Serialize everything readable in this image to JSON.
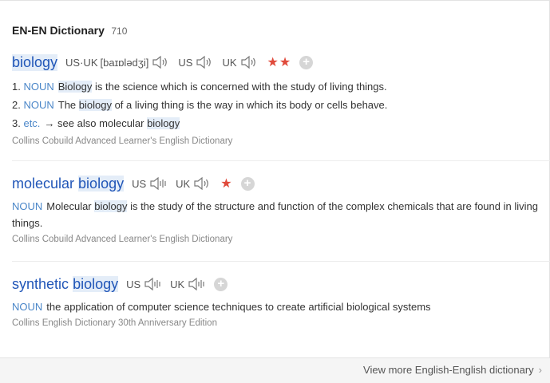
{
  "header": {
    "title": "EN-EN Dictionary",
    "count": "710"
  },
  "entries": [
    {
      "word": "biology",
      "pron": [
        {
          "label": "US·UK",
          "phonetic": "[baɪɒlədʒi]"
        },
        {
          "label": "US",
          "phonetic": ""
        },
        {
          "label": "UK",
          "phonetic": ""
        }
      ],
      "stars": "★★",
      "senses": [
        {
          "num": "1.",
          "pos": "NOUN",
          "parts": [
            "",
            "Biology",
            " is the science which is concerned with the study of living things."
          ]
        },
        {
          "num": "2.",
          "pos": "NOUN",
          "parts": [
            "The ",
            "biology",
            " of a living thing is the way in which its body or cells behave."
          ]
        },
        {
          "num": "3.",
          "pos": "etc.",
          "parts": [
            "→ see also molecular ",
            "biology",
            ""
          ]
        }
      ],
      "source": "Collins Cobuild Advanced Learner's English Dictionary"
    },
    {
      "word_a": "molecular",
      "word_b": "biology",
      "pron": [
        {
          "label": "US"
        },
        {
          "label": "UK"
        }
      ],
      "stars": "★",
      "def": {
        "pos": "NOUN",
        "parts": [
          "Molecular ",
          "biology",
          " is the study of the structure and function of the complex chemicals that are found in living things."
        ]
      },
      "source": "Collins Cobuild Advanced Learner's English Dictionary"
    },
    {
      "word_a": "synthetic",
      "word_b": "biology",
      "pron": [
        {
          "label": "US"
        },
        {
          "label": "UK"
        }
      ],
      "def": {
        "pos": "NOUN",
        "text": "the application of computer science techniques to create artificial biological systems"
      },
      "source": "Collins English Dictionary 30th Anniversary Edition"
    }
  ],
  "footer": {
    "more_link": "View more English-English dictionary",
    "chevron": "›"
  },
  "icons": {
    "speaker": "speaker-icon",
    "add": "add-icon"
  },
  "colors": {
    "link": "#2156b8",
    "pos": "#4a86c8",
    "star": "#e04a3b",
    "highlight": "#e4edf8"
  }
}
